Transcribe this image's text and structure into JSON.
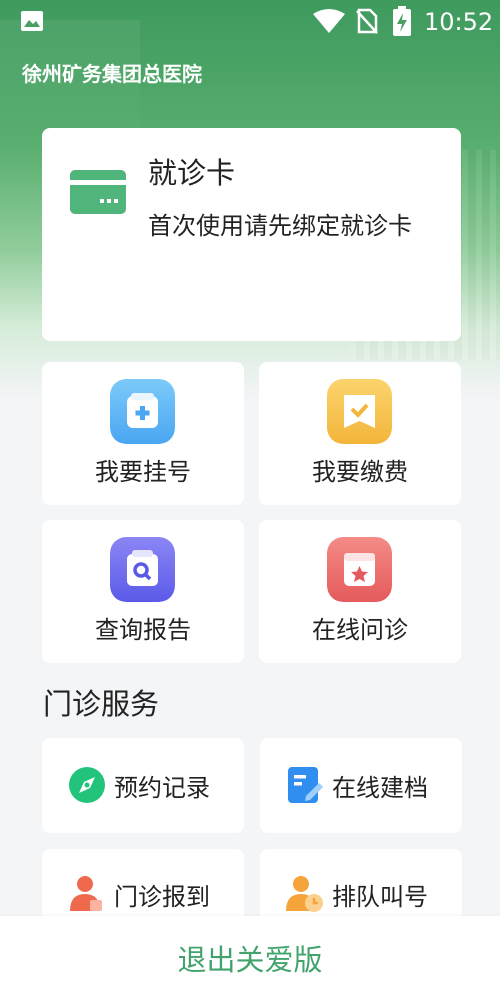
{
  "status_bar": {
    "time": "10:52"
  },
  "header": {
    "hospital_name": "徐州矿务集团总医院"
  },
  "visit_card": {
    "title": "就诊卡",
    "description": "首次使用请先绑定就诊卡"
  },
  "quick_actions": [
    {
      "label": "我要挂号",
      "icon": "hospital-bag-icon",
      "color": "#58b4f5"
    },
    {
      "label": "我要缴费",
      "icon": "payment-check-icon",
      "color": "#f6c14f"
    },
    {
      "label": "查询报告",
      "icon": "report-search-icon",
      "color": "#6c6cf0"
    },
    {
      "label": "在线问诊",
      "icon": "consultation-star-icon",
      "color": "#ee6e6e"
    }
  ],
  "outpatient": {
    "section_title": "门诊服务",
    "items": [
      {
        "label": "预约记录",
        "icon": "compass-icon"
      },
      {
        "label": "在线建档",
        "icon": "document-edit-icon"
      },
      {
        "label": "门诊报到",
        "icon": "person-checkin-icon"
      },
      {
        "label": "排队叫号",
        "icon": "queue-clock-icon"
      }
    ]
  },
  "footer": {
    "exit_label": "退出关爱版"
  },
  "colors": {
    "brand_green": "#42a46c",
    "card_green": "#4fb57a"
  }
}
